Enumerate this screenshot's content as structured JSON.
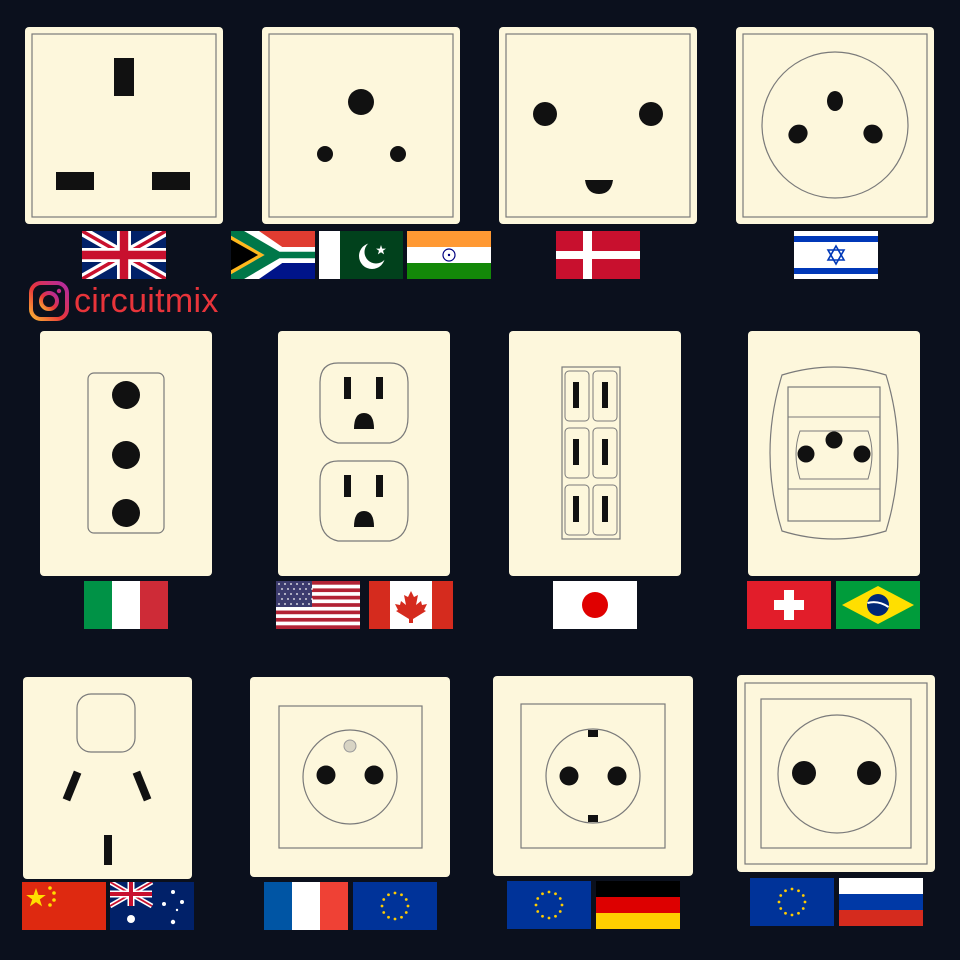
{
  "brand": {
    "platform_icon": "instagram-icon",
    "handle": "circuitmix",
    "accent_color": "#e8343a"
  },
  "colors": {
    "background": "#0b101d",
    "plate": "#fdf7dc",
    "outline": "#7a7a7a",
    "hole": "#111111"
  },
  "sockets": [
    {
      "plug_type": "Type G",
      "flags": [
        "united-kingdom"
      ]
    },
    {
      "plug_type": "Type D",
      "flags": [
        "south-africa",
        "pakistan",
        "india"
      ]
    },
    {
      "plug_type": "Type K",
      "flags": [
        "denmark"
      ]
    },
    {
      "plug_type": "Type H",
      "flags": [
        "israel"
      ]
    },
    {
      "plug_type": "Type L",
      "flags": [
        "italy"
      ]
    },
    {
      "plug_type": "Type B",
      "flags": [
        "united-states",
        "canada"
      ]
    },
    {
      "plug_type": "Type A",
      "flags": [
        "japan"
      ]
    },
    {
      "plug_type": "Type J",
      "flags": [
        "switzerland",
        "brazil"
      ]
    },
    {
      "plug_type": "Type I",
      "flags": [
        "china",
        "australia"
      ]
    },
    {
      "plug_type": "Type E",
      "flags": [
        "france",
        "european-union"
      ]
    },
    {
      "plug_type": "Type F",
      "flags": [
        "european-union",
        "germany"
      ]
    },
    {
      "plug_type": "Type C",
      "flags": [
        "european-union",
        "russia"
      ]
    }
  ]
}
